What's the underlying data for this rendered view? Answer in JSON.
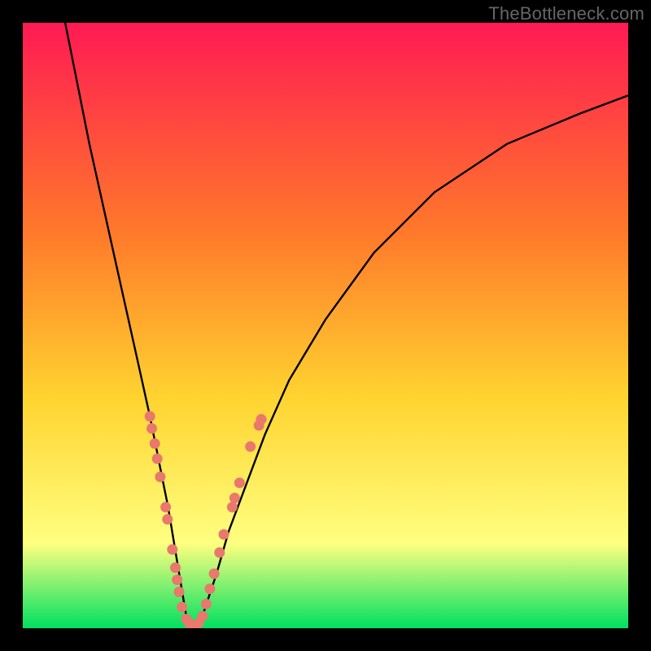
{
  "watermark": "TheBottleneck.com",
  "colors": {
    "top": "#ff1a53",
    "mid1": "#ff7a2a",
    "mid2": "#ffd430",
    "mid3": "#ffff80",
    "bottom": "#00e060",
    "curve": "#000000",
    "dot": "#e9786d"
  },
  "chart_data": {
    "type": "line",
    "title": "",
    "xlabel": "",
    "ylabel": "",
    "xlim": [
      0,
      100
    ],
    "ylim": [
      0,
      100
    ],
    "curve": {
      "x": [
        7,
        9,
        11,
        13,
        15,
        17,
        19,
        21,
        22,
        23,
        24,
        25,
        26,
        27,
        28,
        29,
        30,
        32,
        34,
        37,
        40,
        44,
        50,
        58,
        68,
        80,
        92,
        100
      ],
      "y": [
        100,
        90,
        80,
        71,
        62,
        53,
        44,
        35,
        30,
        25,
        20,
        14,
        8,
        2,
        0,
        0,
        3,
        9,
        16,
        24,
        32,
        41,
        51,
        62,
        72,
        80,
        85,
        88
      ]
    },
    "dots": [
      {
        "x": 21.0,
        "y": 35.0
      },
      {
        "x": 21.3,
        "y": 33.0
      },
      {
        "x": 21.8,
        "y": 30.5
      },
      {
        "x": 22.2,
        "y": 28.0
      },
      {
        "x": 22.7,
        "y": 25.0
      },
      {
        "x": 23.6,
        "y": 20.0
      },
      {
        "x": 23.9,
        "y": 18.0
      },
      {
        "x": 24.7,
        "y": 13.0
      },
      {
        "x": 25.2,
        "y": 10.0
      },
      {
        "x": 25.5,
        "y": 8.0
      },
      {
        "x": 25.8,
        "y": 6.0
      },
      {
        "x": 26.3,
        "y": 3.5
      },
      {
        "x": 27.0,
        "y": 1.5
      },
      {
        "x": 27.5,
        "y": 0.8
      },
      {
        "x": 28.3,
        "y": 0.5
      },
      {
        "x": 29.0,
        "y": 0.8
      },
      {
        "x": 29.7,
        "y": 2.0
      },
      {
        "x": 30.3,
        "y": 4.0
      },
      {
        "x": 30.9,
        "y": 6.5
      },
      {
        "x": 31.6,
        "y": 9.0
      },
      {
        "x": 32.5,
        "y": 12.5
      },
      {
        "x": 33.2,
        "y": 15.5
      },
      {
        "x": 34.6,
        "y": 20.0
      },
      {
        "x": 35.0,
        "y": 21.5
      },
      {
        "x": 35.8,
        "y": 24.0
      },
      {
        "x": 37.6,
        "y": 30.0
      },
      {
        "x": 39.0,
        "y": 33.5
      },
      {
        "x": 39.4,
        "y": 34.5
      }
    ]
  }
}
